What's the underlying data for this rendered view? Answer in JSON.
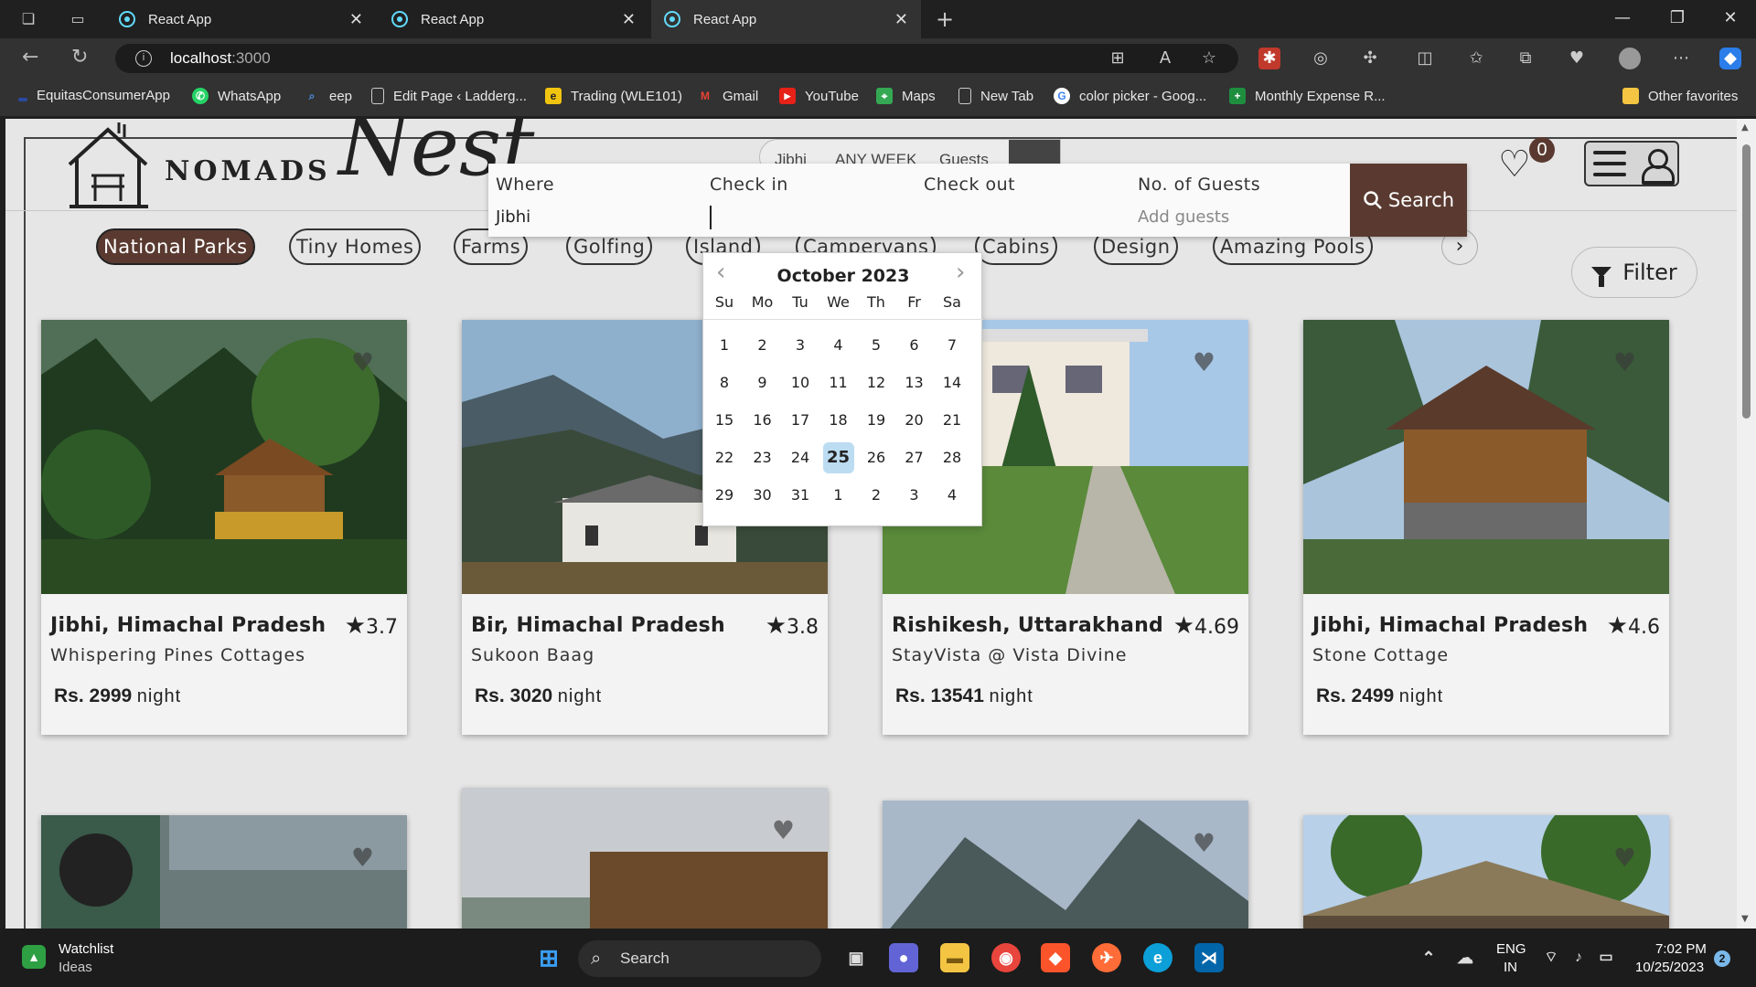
{
  "browser": {
    "tabs": [
      {
        "label": "React App",
        "active": false
      },
      {
        "label": "React App",
        "active": false
      },
      {
        "label": "React App",
        "active": true
      }
    ],
    "url_host": "localhost",
    "url_port": ":3000",
    "bookmarks": [
      {
        "label": "EquitasConsumerApp",
        "icon": "equitas-icon"
      },
      {
        "label": "WhatsApp",
        "icon": "whatsapp-icon"
      },
      {
        "label": "eep",
        "icon": "search-icon"
      },
      {
        "label": "Edit Page ‹ Ladderg...",
        "icon": "page-icon"
      },
      {
        "label": "Trading (WLE101)",
        "icon": "trading-icon"
      },
      {
        "label": "Gmail",
        "icon": "gmail-icon"
      },
      {
        "label": "YouTube",
        "icon": "youtube-icon"
      },
      {
        "label": "Maps",
        "icon": "maps-icon"
      },
      {
        "label": "New Tab",
        "icon": "page-icon"
      },
      {
        "label": "color picker - Goog...",
        "icon": "google-icon"
      },
      {
        "label": "Monthly Expense R...",
        "icon": "sheets-icon"
      }
    ],
    "other_favorites": "Other favorites"
  },
  "site": {
    "brand": "NOMADS",
    "brand_script": "Nest",
    "mini_search": {
      "where": "Jibhi",
      "week": "ANY WEEK",
      "guests": "Guests"
    },
    "wishlist_count": "0",
    "search": {
      "where_label": "Where",
      "where_value": "Jibhi",
      "checkin_label": "Check in",
      "checkout_label": "Check out",
      "guests_label": "No. of Guests",
      "guests_placeholder": "Add guests",
      "button": "Search"
    },
    "categories": [
      "National Parks",
      "Tiny Homes",
      "Farms",
      "Golfing",
      "Island",
      "Campervans",
      "Cabins",
      "Design",
      "Amazing Pools"
    ],
    "active_category": "National Parks",
    "filter_label": "Filter",
    "listings": [
      {
        "location": "Jibhi, Himachal Pradesh",
        "rating": "3.7",
        "name": "Whispering Pines Cottages",
        "price": "Rs. 2999",
        "unit": "night"
      },
      {
        "location": "Bir, Himachal Pradesh",
        "rating": "3.8",
        "name": "Sukoon Baag",
        "price": "Rs. 3020",
        "unit": "night"
      },
      {
        "location": "Rishikesh, Uttarakhand",
        "rating": "4.69",
        "name": "StayVista @ Vista Divine",
        "price": "Rs. 13541",
        "unit": "night"
      },
      {
        "location": "Jibhi, Himachal Pradesh",
        "rating": "4.6",
        "name": "Stone Cottage",
        "price": "Rs. 2499",
        "unit": "night"
      }
    ],
    "calendar": {
      "month": "October 2023",
      "weekdays": [
        "Su",
        "Mo",
        "Tu",
        "We",
        "Th",
        "Fr",
        "Sa"
      ],
      "weeks": [
        [
          "1",
          "2",
          "3",
          "4",
          "5",
          "6",
          "7"
        ],
        [
          "8",
          "9",
          "10",
          "11",
          "12",
          "13",
          "14"
        ],
        [
          "15",
          "16",
          "17",
          "18",
          "19",
          "20",
          "21"
        ],
        [
          "22",
          "23",
          "24",
          "25",
          "26",
          "27",
          "28"
        ],
        [
          "29",
          "30",
          "31",
          "1",
          "2",
          "3",
          "4"
        ]
      ],
      "selected": "25"
    }
  },
  "taskbar": {
    "widget_title": "Watchlist",
    "widget_sub": "Ideas",
    "search": "Search",
    "lang": "ENG",
    "region": "IN",
    "time": "7:02 PM",
    "date": "10/25/2023",
    "notifications": "2"
  },
  "colors": {
    "accent": "#5a3a30",
    "selected_day": "#bcdcf2",
    "page_bg": "#e6e6e6"
  }
}
